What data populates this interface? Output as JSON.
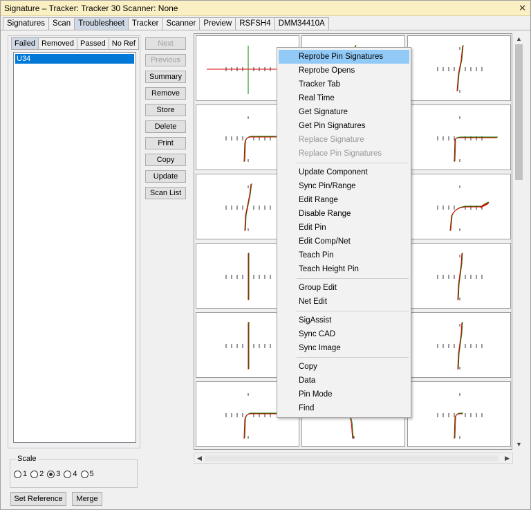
{
  "window": {
    "title": "Signature – Tracker: Tracker 30  Scanner: None",
    "close_glyph": "✕"
  },
  "tabs": [
    "Signatures",
    "Scan",
    "Troublesheet",
    "Tracker",
    "Scanner",
    "Preview",
    "RSFSH4",
    "DMM34410A"
  ],
  "active_tab": "Troubleshoot",
  "list_tabs": [
    "Failed",
    "Removed",
    "Passed",
    "No Ref"
  ],
  "active_list_tab": "Failed",
  "failed_list": [
    "U34"
  ],
  "buttons": [
    {
      "label": "Next",
      "enabled": false
    },
    {
      "label": "Previous",
      "enabled": false
    },
    {
      "label": "Summary",
      "enabled": true
    },
    {
      "label": "Remove",
      "enabled": true
    },
    {
      "label": "Store",
      "enabled": true
    },
    {
      "label": "Delete",
      "enabled": true
    },
    {
      "label": "Print",
      "enabled": true
    },
    {
      "label": "Copy",
      "enabled": true
    },
    {
      "label": "Update",
      "enabled": true
    },
    {
      "label": "Scan List",
      "enabled": true
    }
  ],
  "scale": {
    "label": "Scale",
    "options": [
      "1",
      "2",
      "3",
      "4",
      "5"
    ],
    "selected": "3"
  },
  "bottom_buttons": {
    "set_reference": "Set Reference",
    "merge": "Merge"
  },
  "context_menu": {
    "items": [
      {
        "label": "Reprobe Pin Signatures",
        "highlighted": true
      },
      {
        "label": "Reprobe Opens"
      },
      {
        "label": "Tracker Tab"
      },
      {
        "label": "Real Time"
      },
      {
        "label": "Get Signature"
      },
      {
        "label": "Get Pin Signatures"
      },
      {
        "label": "Replace Signature",
        "disabled": true
      },
      {
        "label": "Replace Pin Signatures",
        "disabled": true
      },
      {
        "separator": true
      },
      {
        "label": "Update Component"
      },
      {
        "label": "Sync Pin/Range"
      },
      {
        "label": "Edit Range"
      },
      {
        "label": "Disable Range"
      },
      {
        "label": "Edit Pin"
      },
      {
        "label": "Edit Comp/Net"
      },
      {
        "label": "Teach Pin"
      },
      {
        "label": "Teach Height Pin"
      },
      {
        "separator": true
      },
      {
        "label": "Group Edit"
      },
      {
        "label": "Net Edit"
      },
      {
        "separator": true
      },
      {
        "label": "SigAssist"
      },
      {
        "label": "Sync CAD"
      },
      {
        "label": "Sync Image"
      },
      {
        "separator": true
      },
      {
        "label": "Copy"
      },
      {
        "label": "Data"
      },
      {
        "label": "Pin Mode"
      },
      {
        "label": "Find"
      }
    ]
  },
  "signature_panels": [
    {
      "curve": "cross"
    },
    {
      "curve": "ramp-hi"
    },
    {
      "curve": "diag"
    },
    {
      "curve": "knee"
    },
    {
      "curve": "knee-r"
    },
    {
      "curve": "knee-r"
    },
    {
      "curve": "steep"
    },
    {
      "curve": "steep"
    },
    {
      "curve": "loop"
    },
    {
      "curve": "vline"
    },
    {
      "curve": "vline"
    },
    {
      "curve": "steep2"
    },
    {
      "curve": "vline"
    },
    {
      "curve": "vline"
    },
    {
      "curve": "steep2"
    },
    {
      "curve": "knee"
    },
    {
      "curve": "knee-b"
    },
    {
      "curve": "knee-s"
    }
  ],
  "colors": {
    "accent": "#0078d7",
    "menu_highlight": "#91c9f7",
    "title_bg": "#fbf0c4",
    "trace_red": "#e00000",
    "trace_green": "#008000"
  }
}
